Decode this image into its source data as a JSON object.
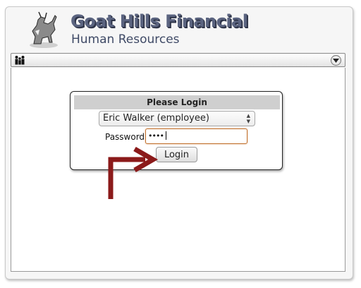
{
  "brand": {
    "title": "Goat Hills Financial",
    "subtitle": "Human Resources",
    "logo_icon": "goat-logo"
  },
  "menubar": {
    "left_icon": "people-icon",
    "right_icon": "chevron-down-icon"
  },
  "login": {
    "header": "Please Login",
    "selected_user": "Eric Walker (employee)",
    "password_label": "Password",
    "password_value": "••••",
    "button_label": "Login"
  },
  "annotation": {
    "arrow_color": "#8b1a1a"
  }
}
